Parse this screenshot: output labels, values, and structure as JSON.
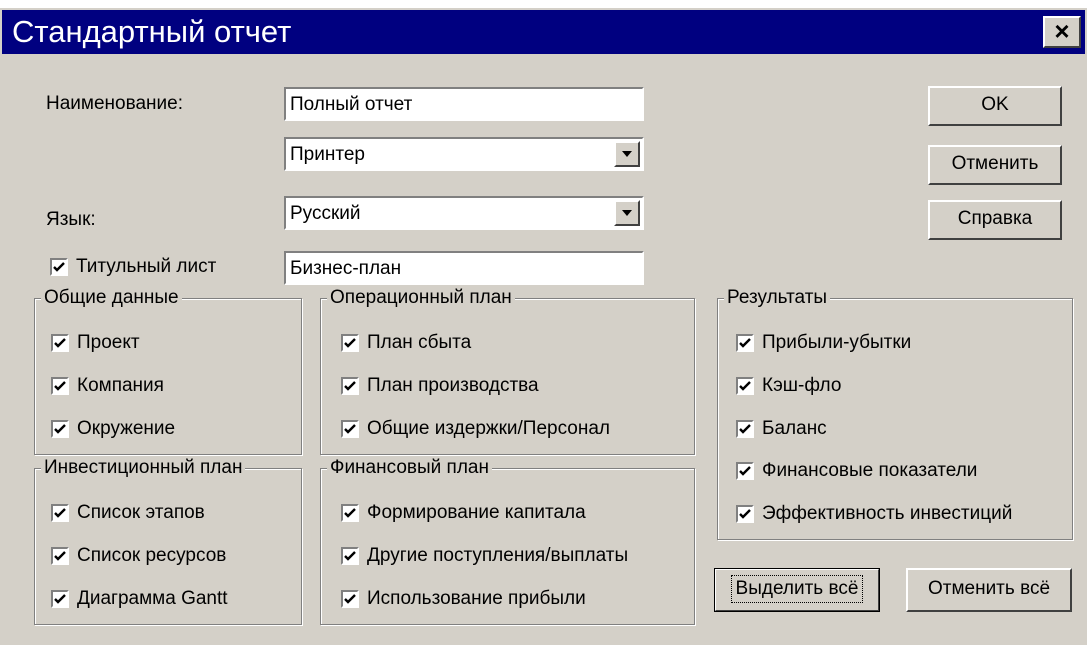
{
  "window": {
    "title": "Стандартный отчет",
    "close_label": "×"
  },
  "form": {
    "name_label": "Наименование:",
    "name_value": "Полный отчет",
    "output_value": "Принтер",
    "language_label": "Язык:",
    "language_value": "Русский",
    "title_page": {
      "label": "Титульный лист",
      "checked": true
    },
    "title_page_value": "Бизнес-план"
  },
  "buttons": {
    "ok": "OK",
    "cancel": "Отменить",
    "help": "Справка",
    "select_all": "Выделить всё",
    "deselect_all": "Отменить всё"
  },
  "groups": {
    "general": {
      "caption": "Общие данные",
      "items": [
        {
          "label": "Проект",
          "checked": true
        },
        {
          "label": "Компания",
          "checked": true
        },
        {
          "label": "Окружение",
          "checked": true
        }
      ]
    },
    "operational": {
      "caption": "Операционный план",
      "items": [
        {
          "label": "План сбыта",
          "checked": true
        },
        {
          "label": "План производства",
          "checked": true
        },
        {
          "label": "Общие издержки/Персонал",
          "checked": true
        }
      ]
    },
    "results": {
      "caption": "Результаты",
      "items": [
        {
          "label": "Прибыли-убытки",
          "checked": true
        },
        {
          "label": "Кэш-фло",
          "checked": true
        },
        {
          "label": "Баланс",
          "checked": true
        },
        {
          "label": "Финансовые показатели",
          "checked": true
        },
        {
          "label": "Эффективность инвестиций",
          "checked": true
        }
      ]
    },
    "investment": {
      "caption": "Инвестиционный план",
      "items": [
        {
          "label": "Список этапов",
          "checked": true
        },
        {
          "label": "Список ресурсов",
          "checked": true
        },
        {
          "label": "Диаграмма Gantt",
          "checked": true
        }
      ]
    },
    "financial": {
      "caption": "Финансовый план",
      "items": [
        {
          "label": "Формирование капитала",
          "checked": true
        },
        {
          "label": "Другие поступления/выплаты",
          "checked": true
        },
        {
          "label": "Использование прибыли",
          "checked": true
        }
      ]
    }
  }
}
